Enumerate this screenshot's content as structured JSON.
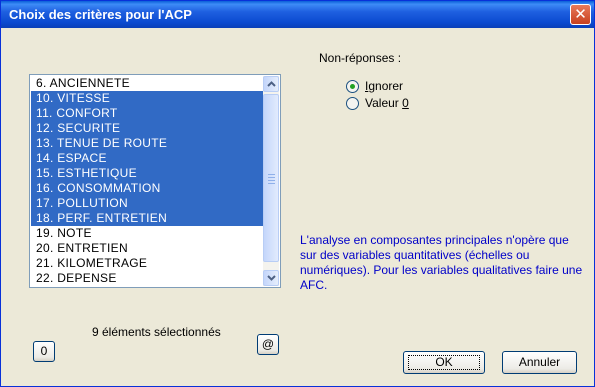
{
  "window": {
    "title": "Choix des critères pour l'ACP"
  },
  "list": {
    "items": [
      {
        "label": "6. ANCIENNETE",
        "selected": false
      },
      {
        "label": "10. VITESSE",
        "selected": true
      },
      {
        "label": "11. CONFORT",
        "selected": true
      },
      {
        "label": "12. SECURITE",
        "selected": true
      },
      {
        "label": "13. TENUE DE ROUTE",
        "selected": true
      },
      {
        "label": "14. ESPACE",
        "selected": true
      },
      {
        "label": "15. ESTHETIQUE",
        "selected": true
      },
      {
        "label": "16. CONSOMMATION",
        "selected": true
      },
      {
        "label": "17. POLLUTION",
        "selected": true
      },
      {
        "label": "18. PERF. ENTRETIEN",
        "selected": true
      },
      {
        "label": "19. NOTE",
        "selected": false
      },
      {
        "label": "20. ENTRETIEN",
        "selected": false
      },
      {
        "label": "21. KILOMETRAGE",
        "selected": false
      },
      {
        "label": "22. DEPENSE",
        "selected": false
      }
    ]
  },
  "nonresponse": {
    "label": "Non-réponses :",
    "option_ignore_mnemonic": "I",
    "option_ignore_rest": "gnorer",
    "option_value_prefix": "Valeur ",
    "option_value_mnemonic": "0",
    "selected": "ignore"
  },
  "info": {
    "text": "L'analyse en composantes principales n'opère que sur des variables quantitatives (échelles ou numériques). Pour les variables qualitatives faire une AFC.",
    "color": "#0000c8"
  },
  "selection": {
    "clear_label": "0",
    "count_text": "9 éléments sélectionnés",
    "all_label": "@"
  },
  "buttons": {
    "ok": "OK",
    "cancel": "Annuler"
  },
  "colors": {
    "selection": "#316ac5",
    "titlebar": "#0b4ad0",
    "dialog": "#ece9d8"
  },
  "icons": {
    "close": "close-icon"
  }
}
